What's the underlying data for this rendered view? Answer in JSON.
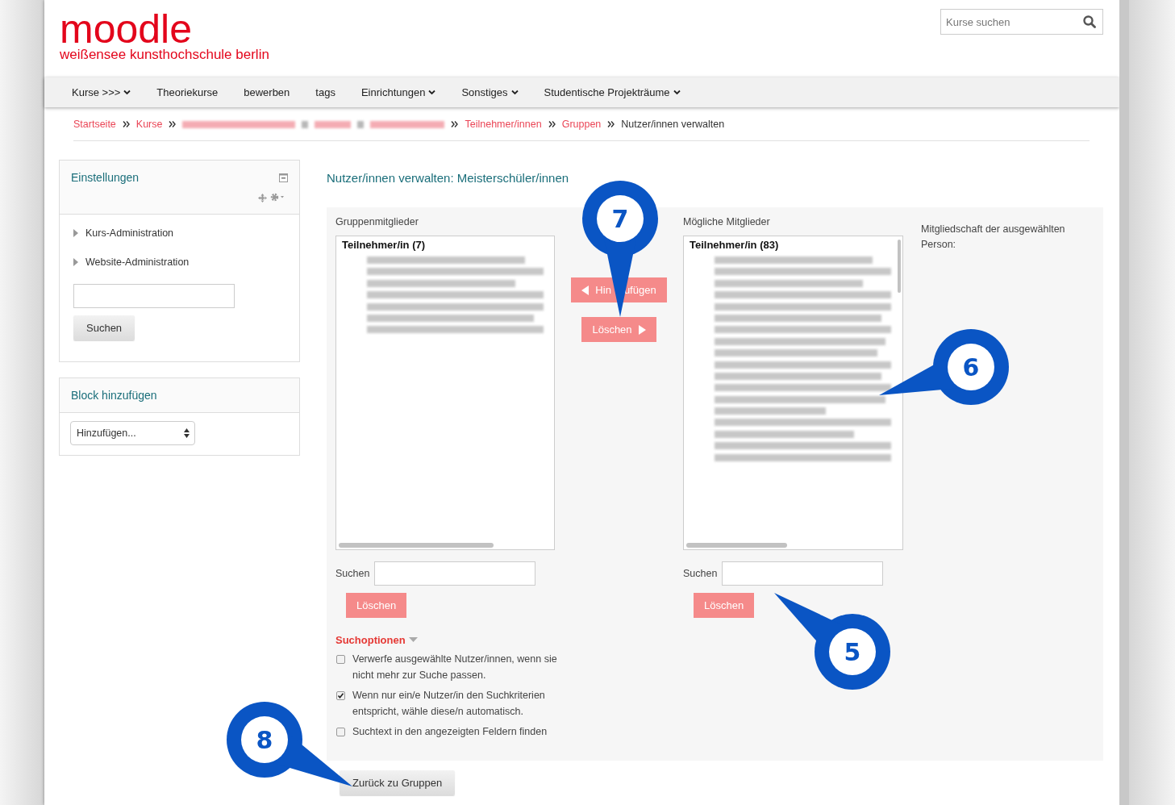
{
  "header": {
    "logo": "moodle",
    "logo_subtitle": "weißensee kunsthochschule berlin",
    "search": {
      "placeholder": "Kurse suchen"
    }
  },
  "nav": [
    {
      "label": "Kurse >>>",
      "dropdown": true
    },
    {
      "label": "Theoriekurse",
      "dropdown": false
    },
    {
      "label": "bewerben",
      "dropdown": false
    },
    {
      "label": "tags",
      "dropdown": false
    },
    {
      "label": "Einrichtungen",
      "dropdown": true
    },
    {
      "label": "Sonstiges",
      "dropdown": true
    },
    {
      "label": "Studentische Projekträume",
      "dropdown": true
    }
  ],
  "breadcrumb": [
    {
      "kind": "link",
      "label": "Startseite"
    },
    {
      "kind": "link",
      "label": "Kurse"
    },
    {
      "kind": "redacted"
    },
    {
      "kind": "link",
      "label": "Teilnehmer/innen"
    },
    {
      "kind": "link",
      "label": "Gruppen"
    },
    {
      "kind": "current",
      "label": "Nutzer/innen verwalten"
    }
  ],
  "sidebar": {
    "settings": {
      "title": "Einstellungen",
      "items": [
        {
          "label": "Kurs-Administration",
          "expanded": false
        },
        {
          "label": "Website-Administration",
          "expanded": false
        }
      ],
      "search_button": "Suchen"
    },
    "add_block": {
      "title": "Block hinzufügen",
      "select": "Hinzufügen..."
    }
  },
  "main": {
    "title": "Nutzer/innen verwalten: Meisterschüler/innen",
    "members": {
      "label": "Gruppenmitglieder",
      "group": "Teilnehmer/in (7)",
      "entries": [
        {
          "kind": "redacted"
        },
        {
          "kind": "redacted"
        },
        {
          "kind": "redacted"
        },
        {
          "kind": "redacted"
        },
        {
          "kind": "redacted"
        },
        {
          "kind": "redacted"
        },
        {
          "kind": "redacted"
        }
      ],
      "search_label": "Suchen",
      "clear_button": "Löschen"
    },
    "add_button": [
      "Hin",
      "ufügen"
    ],
    "remove_button": "Löschen",
    "candidates": {
      "label": "Mögliche Mitglieder",
      "group": "Teilnehmer/in (83)",
      "entries": [
        {
          "kind": "redacted"
        },
        {
          "kind": "redacted"
        },
        {
          "kind": "redacted"
        },
        {
          "kind": "redacted"
        },
        {
          "kind": "redacted"
        },
        {
          "kind": "redacted"
        },
        {
          "kind": "redacted"
        },
        {
          "kind": "redacted"
        },
        {
          "kind": "redacted"
        },
        {
          "kind": "redacted"
        },
        {
          "kind": "redacted"
        },
        {
          "kind": "redacted"
        },
        {
          "kind": "redacted"
        },
        {
          "kind": "redacted"
        },
        {
          "kind": "redacted"
        },
        {
          "kind": "redacted"
        },
        {
          "kind": "redacted"
        },
        {
          "kind": "redacted"
        }
      ],
      "search_label": "Suchen",
      "clear_button": "Löschen"
    },
    "selection_info": "Mitgliedschaft der ausgewählten Person:",
    "search_options": {
      "title": "Suchoptionen",
      "items": [
        {
          "label": "Verwerfe ausgewählte Nutzer/innen, wenn sie nicht mehr zur Suche passen.",
          "checked": false
        },
        {
          "label": "Wenn nur ein/e Nutzer/in den Suchkriterien entspricht, wähle diese/n automatisch.",
          "checked": true
        },
        {
          "label": "Suchtext in den angezeigten Feldern finden",
          "checked": false
        }
      ]
    },
    "back_button": "Zurück zu Gruppen"
  },
  "callouts": [
    {
      "number": "7"
    },
    {
      "number": "6"
    },
    {
      "number": "5"
    },
    {
      "number": "8"
    }
  ]
}
